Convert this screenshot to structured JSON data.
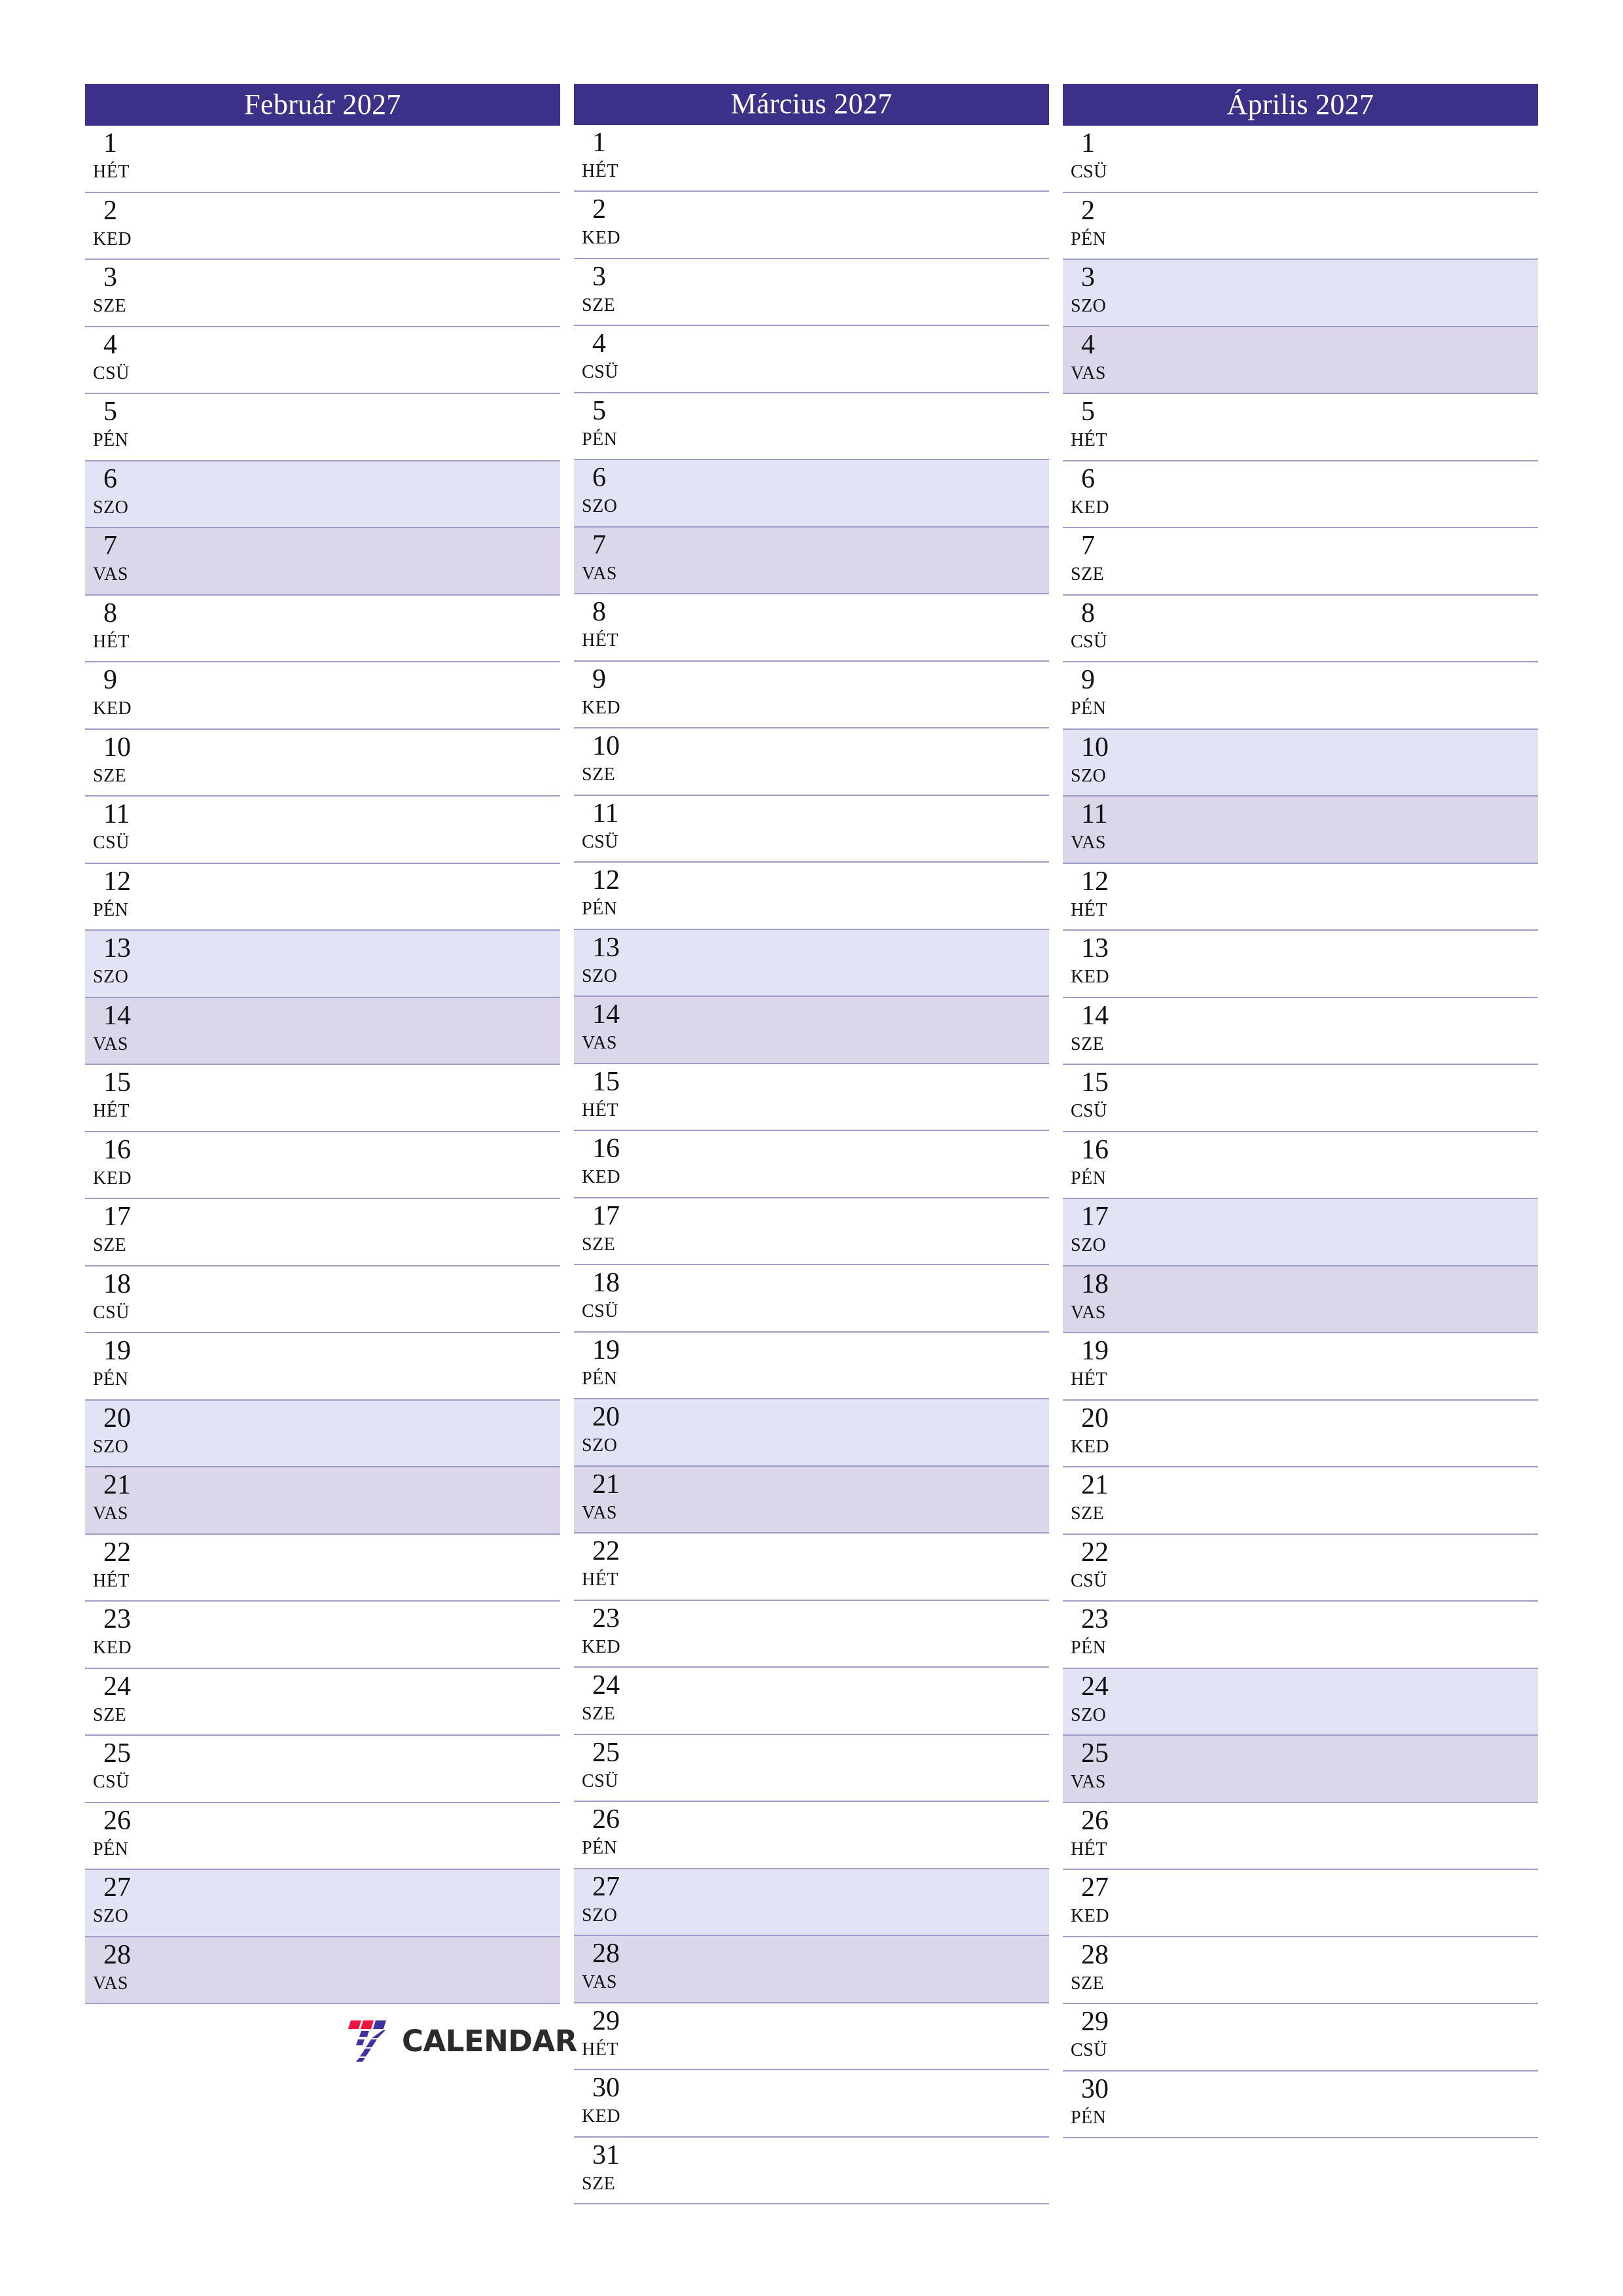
{
  "document": {
    "type": "calendar-planner",
    "year": 2027,
    "language": "hu",
    "page_size": "A4 portrait"
  },
  "colors": {
    "header_bg": "#3c3189",
    "header_text": "#ffffff",
    "row_divider": "#9d9dc6",
    "saturday_bg": "#e3e3f6",
    "sunday_bg": "#dcd6ea",
    "day_text": "#111111",
    "logo_red": "#f01440",
    "logo_purple": "#3d32a0",
    "logo_text": "#2b2b2e"
  },
  "logo": {
    "mark_name": "seven-calendar-logo-mark",
    "text": "CALENDAR"
  },
  "months": [
    {
      "title": "Február 2027",
      "name": "Február",
      "index": 2,
      "days": [
        {
          "num": "1",
          "abbr": "HÉT",
          "kind": "weekday"
        },
        {
          "num": "2",
          "abbr": "KED",
          "kind": "weekday"
        },
        {
          "num": "3",
          "abbr": "SZE",
          "kind": "weekday"
        },
        {
          "num": "4",
          "abbr": "CSÜ",
          "kind": "weekday"
        },
        {
          "num": "5",
          "abbr": "PÉN",
          "kind": "weekday"
        },
        {
          "num": "6",
          "abbr": "SZO",
          "kind": "sat"
        },
        {
          "num": "7",
          "abbr": "VAS",
          "kind": "sun"
        },
        {
          "num": "8",
          "abbr": "HÉT",
          "kind": "weekday"
        },
        {
          "num": "9",
          "abbr": "KED",
          "kind": "weekday"
        },
        {
          "num": "10",
          "abbr": "SZE",
          "kind": "weekday"
        },
        {
          "num": "11",
          "abbr": "CSÜ",
          "kind": "weekday"
        },
        {
          "num": "12",
          "abbr": "PÉN",
          "kind": "weekday"
        },
        {
          "num": "13",
          "abbr": "SZO",
          "kind": "sat"
        },
        {
          "num": "14",
          "abbr": "VAS",
          "kind": "sun"
        },
        {
          "num": "15",
          "abbr": "HÉT",
          "kind": "weekday"
        },
        {
          "num": "16",
          "abbr": "KED",
          "kind": "weekday"
        },
        {
          "num": "17",
          "abbr": "SZE",
          "kind": "weekday"
        },
        {
          "num": "18",
          "abbr": "CSÜ",
          "kind": "weekday"
        },
        {
          "num": "19",
          "abbr": "PÉN",
          "kind": "weekday"
        },
        {
          "num": "20",
          "abbr": "SZO",
          "kind": "sat"
        },
        {
          "num": "21",
          "abbr": "VAS",
          "kind": "sun"
        },
        {
          "num": "22",
          "abbr": "HÉT",
          "kind": "weekday"
        },
        {
          "num": "23",
          "abbr": "KED",
          "kind": "weekday"
        },
        {
          "num": "24",
          "abbr": "SZE",
          "kind": "weekday"
        },
        {
          "num": "25",
          "abbr": "CSÜ",
          "kind": "weekday"
        },
        {
          "num": "26",
          "abbr": "PÉN",
          "kind": "weekday"
        },
        {
          "num": "27",
          "abbr": "SZO",
          "kind": "sat"
        },
        {
          "num": "28",
          "abbr": "VAS",
          "kind": "sun"
        }
      ]
    },
    {
      "title": "Március 2027",
      "name": "Március",
      "index": 3,
      "days": [
        {
          "num": "1",
          "abbr": "HÉT",
          "kind": "weekday"
        },
        {
          "num": "2",
          "abbr": "KED",
          "kind": "weekday"
        },
        {
          "num": "3",
          "abbr": "SZE",
          "kind": "weekday"
        },
        {
          "num": "4",
          "abbr": "CSÜ",
          "kind": "weekday"
        },
        {
          "num": "5",
          "abbr": "PÉN",
          "kind": "weekday"
        },
        {
          "num": "6",
          "abbr": "SZO",
          "kind": "sat"
        },
        {
          "num": "7",
          "abbr": "VAS",
          "kind": "sun"
        },
        {
          "num": "8",
          "abbr": "HÉT",
          "kind": "weekday"
        },
        {
          "num": "9",
          "abbr": "KED",
          "kind": "weekday"
        },
        {
          "num": "10",
          "abbr": "SZE",
          "kind": "weekday"
        },
        {
          "num": "11",
          "abbr": "CSÜ",
          "kind": "weekday"
        },
        {
          "num": "12",
          "abbr": "PÉN",
          "kind": "weekday"
        },
        {
          "num": "13",
          "abbr": "SZO",
          "kind": "sat"
        },
        {
          "num": "14",
          "abbr": "VAS",
          "kind": "sun"
        },
        {
          "num": "15",
          "abbr": "HÉT",
          "kind": "weekday"
        },
        {
          "num": "16",
          "abbr": "KED",
          "kind": "weekday"
        },
        {
          "num": "17",
          "abbr": "SZE",
          "kind": "weekday"
        },
        {
          "num": "18",
          "abbr": "CSÜ",
          "kind": "weekday"
        },
        {
          "num": "19",
          "abbr": "PÉN",
          "kind": "weekday"
        },
        {
          "num": "20",
          "abbr": "SZO",
          "kind": "sat"
        },
        {
          "num": "21",
          "abbr": "VAS",
          "kind": "sun"
        },
        {
          "num": "22",
          "abbr": "HÉT",
          "kind": "weekday"
        },
        {
          "num": "23",
          "abbr": "KED",
          "kind": "weekday"
        },
        {
          "num": "24",
          "abbr": "SZE",
          "kind": "weekday"
        },
        {
          "num": "25",
          "abbr": "CSÜ",
          "kind": "weekday"
        },
        {
          "num": "26",
          "abbr": "PÉN",
          "kind": "weekday"
        },
        {
          "num": "27",
          "abbr": "SZO",
          "kind": "sat"
        },
        {
          "num": "28",
          "abbr": "VAS",
          "kind": "sun"
        },
        {
          "num": "29",
          "abbr": "HÉT",
          "kind": "weekday"
        },
        {
          "num": "30",
          "abbr": "KED",
          "kind": "weekday"
        },
        {
          "num": "31",
          "abbr": "SZE",
          "kind": "weekday"
        }
      ]
    },
    {
      "title": "Április 2027",
      "name": "Április",
      "index": 4,
      "days": [
        {
          "num": "1",
          "abbr": "CSÜ",
          "kind": "weekday"
        },
        {
          "num": "2",
          "abbr": "PÉN",
          "kind": "weekday"
        },
        {
          "num": "3",
          "abbr": "SZO",
          "kind": "sat"
        },
        {
          "num": "4",
          "abbr": "VAS",
          "kind": "sun"
        },
        {
          "num": "5",
          "abbr": "HÉT",
          "kind": "weekday"
        },
        {
          "num": "6",
          "abbr": "KED",
          "kind": "weekday"
        },
        {
          "num": "7",
          "abbr": "SZE",
          "kind": "weekday"
        },
        {
          "num": "8",
          "abbr": "CSÜ",
          "kind": "weekday"
        },
        {
          "num": "9",
          "abbr": "PÉN",
          "kind": "weekday"
        },
        {
          "num": "10",
          "abbr": "SZO",
          "kind": "sat"
        },
        {
          "num": "11",
          "abbr": "VAS",
          "kind": "sun"
        },
        {
          "num": "12",
          "abbr": "HÉT",
          "kind": "weekday"
        },
        {
          "num": "13",
          "abbr": "KED",
          "kind": "weekday"
        },
        {
          "num": "14",
          "abbr": "SZE",
          "kind": "weekday"
        },
        {
          "num": "15",
          "abbr": "CSÜ",
          "kind": "weekday"
        },
        {
          "num": "16",
          "abbr": "PÉN",
          "kind": "weekday"
        },
        {
          "num": "17",
          "abbr": "SZO",
          "kind": "sat"
        },
        {
          "num": "18",
          "abbr": "VAS",
          "kind": "sun"
        },
        {
          "num": "19",
          "abbr": "HÉT",
          "kind": "weekday"
        },
        {
          "num": "20",
          "abbr": "KED",
          "kind": "weekday"
        },
        {
          "num": "21",
          "abbr": "SZE",
          "kind": "weekday"
        },
        {
          "num": "22",
          "abbr": "CSÜ",
          "kind": "weekday"
        },
        {
          "num": "23",
          "abbr": "PÉN",
          "kind": "weekday"
        },
        {
          "num": "24",
          "abbr": "SZO",
          "kind": "sat"
        },
        {
          "num": "25",
          "abbr": "VAS",
          "kind": "sun"
        },
        {
          "num": "26",
          "abbr": "HÉT",
          "kind": "weekday"
        },
        {
          "num": "27",
          "abbr": "KED",
          "kind": "weekday"
        },
        {
          "num": "28",
          "abbr": "SZE",
          "kind": "weekday"
        },
        {
          "num": "29",
          "abbr": "CSÜ",
          "kind": "weekday"
        },
        {
          "num": "30",
          "abbr": "PÉN",
          "kind": "weekday"
        }
      ]
    }
  ]
}
